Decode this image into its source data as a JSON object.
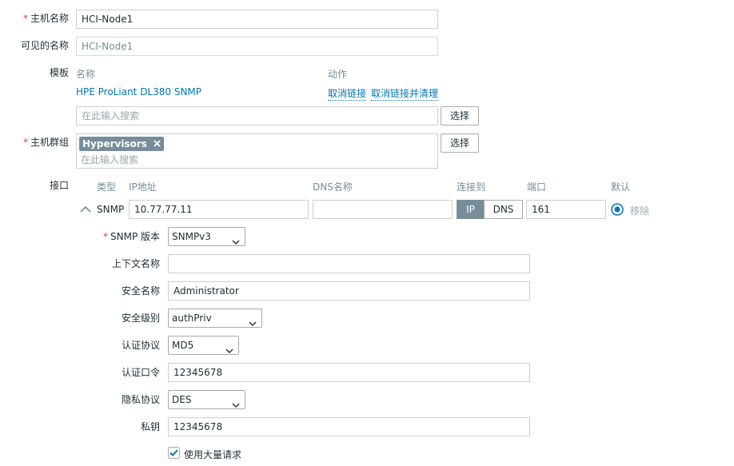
{
  "host_name": {
    "label": "主机名称",
    "value": "HCI-Node1"
  },
  "visible_name": {
    "label": "可见的名称",
    "value": "HCI-Node1"
  },
  "templates": {
    "label": "模板",
    "col_name": "名称",
    "col_action": "动作",
    "rows": [
      {
        "name": "HPE ProLiant DL380 SNMP",
        "unlink": "取消链接",
        "unlink_clear": "取消链接并清理"
      }
    ],
    "search_placeholder": "在此输入搜索",
    "select_button": "选择"
  },
  "host_groups": {
    "label": "主机群组",
    "tags": [
      "Hypervisors"
    ],
    "search_placeholder": "在此输入搜索",
    "select_button": "选择"
  },
  "interfaces": {
    "label": "接口",
    "col_type": "类型",
    "col_ip": "IP地址",
    "col_dns": "DNS名称",
    "col_connect": "连接到",
    "col_port": "端口",
    "col_default": "默认",
    "row": {
      "type": "SNMP",
      "ip": "10.77.77.11",
      "dns": "",
      "connect_ip": "IP",
      "connect_dns": "DNS",
      "port": "161",
      "remove": "移除"
    }
  },
  "snmp": {
    "version_label": "SNMP 版本",
    "version_value": "SNMPv3",
    "context_label": "上下文名称",
    "context_value": "",
    "security_name_label": "安全名称",
    "security_name_value": "Administrator",
    "security_level_label": "安全级别",
    "security_level_value": "authPriv",
    "auth_protocol_label": "认证协议",
    "auth_protocol_value": "MD5",
    "auth_pass_label": "认证口令",
    "auth_pass_value": "12345678",
    "priv_protocol_label": "隐私协议",
    "priv_protocol_value": "DES",
    "priv_key_label": "私钥",
    "priv_key_value": "12345678",
    "bulk_label": "使用大量请求",
    "bulk_checked": true
  },
  "colors": {
    "link": "#0275b8",
    "required": "#e33734",
    "tag_bg": "#778d99",
    "segment_active": "#778d99",
    "radio": "#0275b8"
  },
  "icons": {
    "tag_remove": "close-icon",
    "collapse": "chevron-up-icon",
    "select_arrow": "chevron-down-icon",
    "checkbox": "check-icon"
  }
}
